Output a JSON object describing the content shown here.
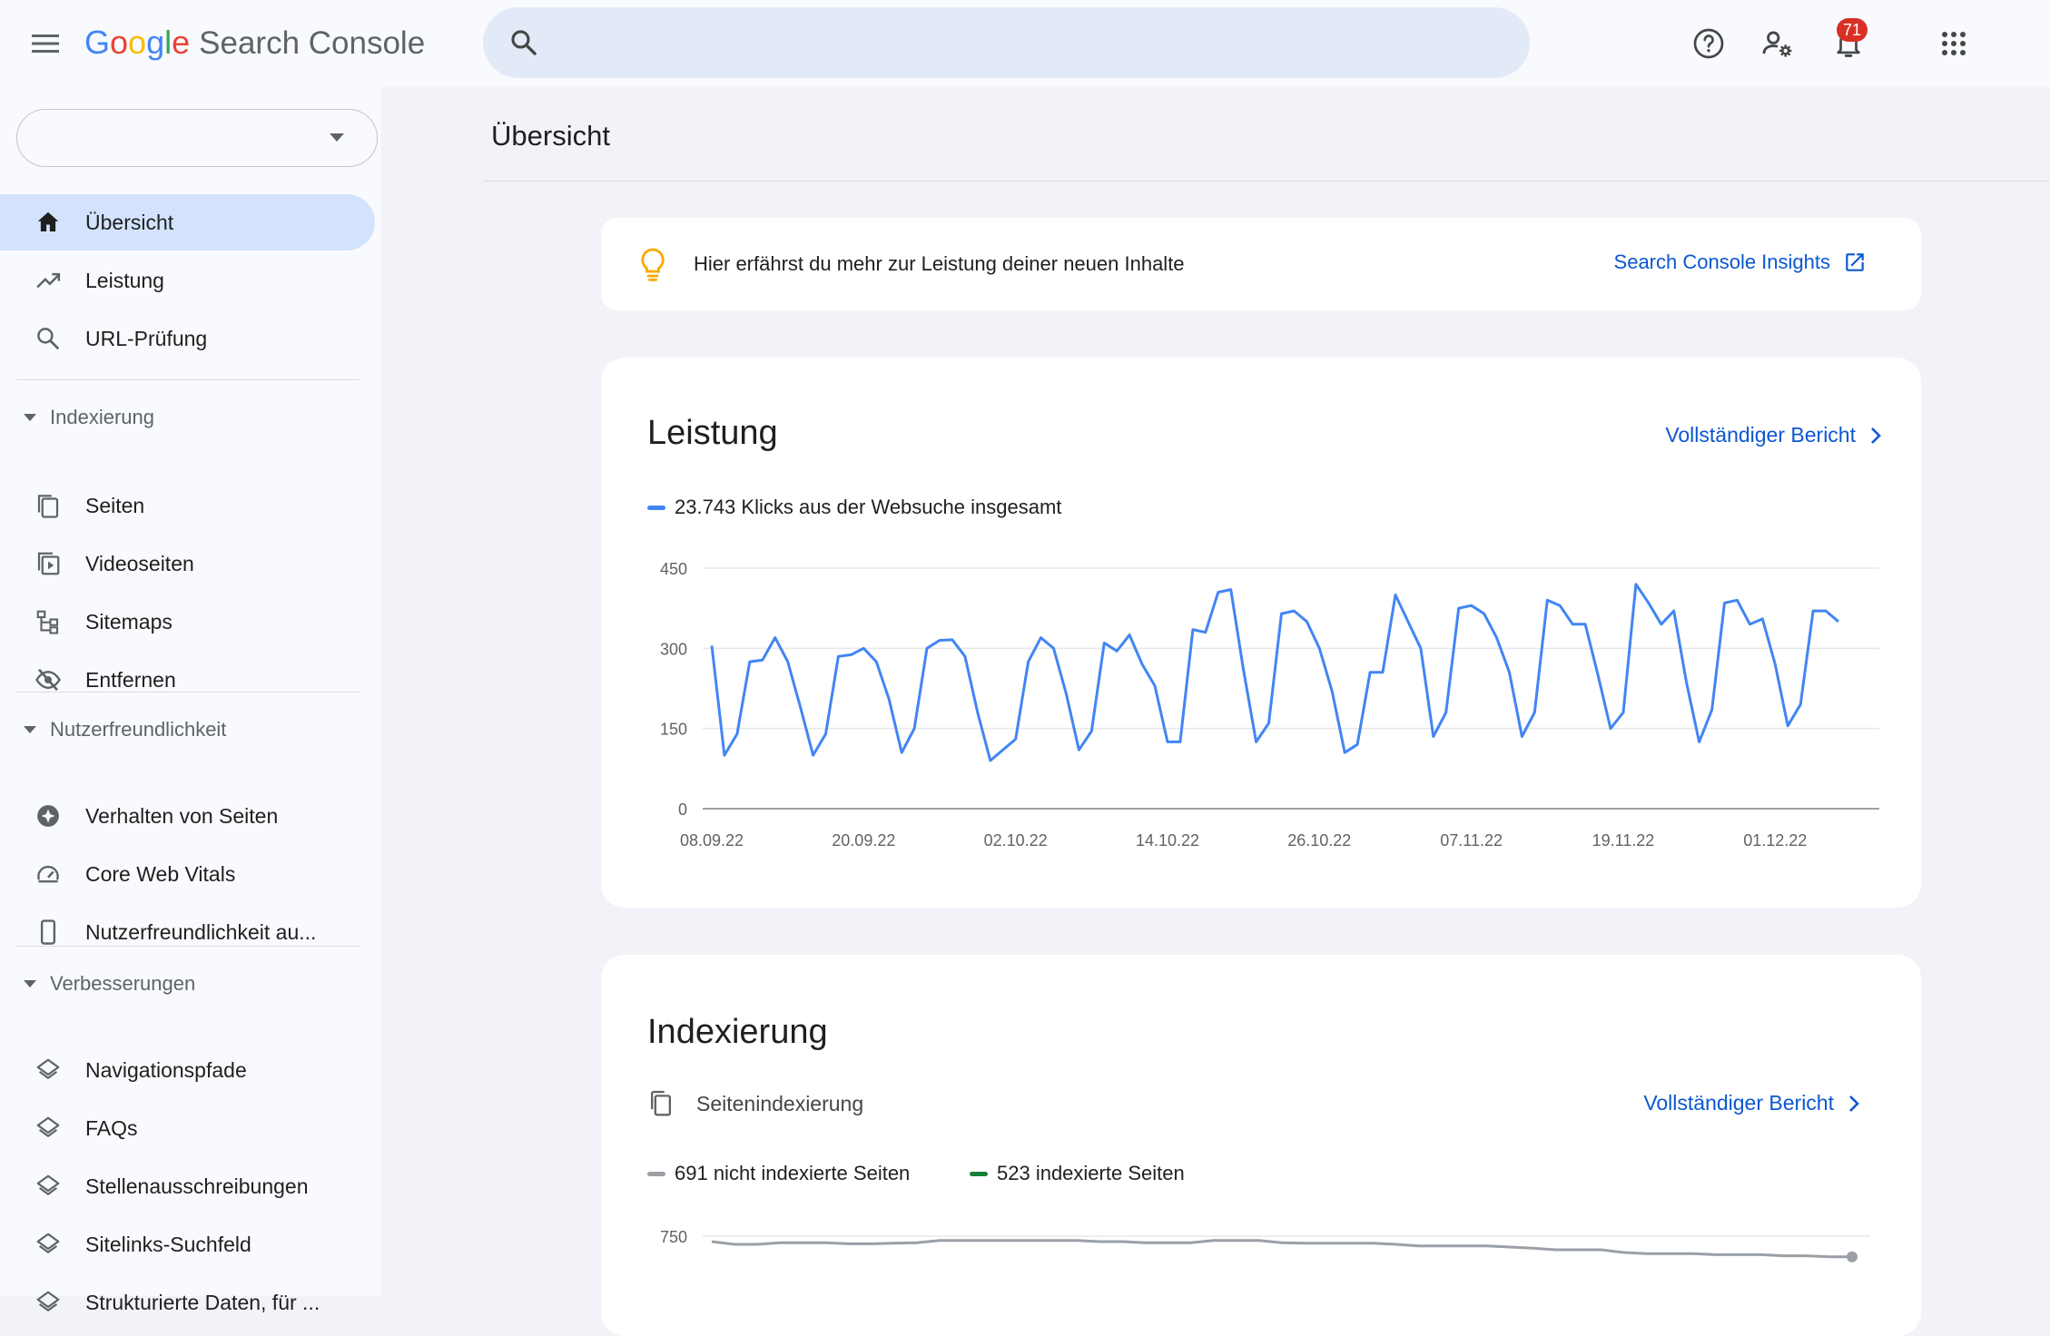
{
  "app": {
    "logo_letters": [
      {
        "ch": "G",
        "color": "#4285f4"
      },
      {
        "ch": "o",
        "color": "#ea4335"
      },
      {
        "ch": "o",
        "color": "#fbbc05"
      },
      {
        "ch": "g",
        "color": "#4285f4"
      },
      {
        "ch": "l",
        "color": "#34a853"
      },
      {
        "ch": "e",
        "color": "#ea4335"
      }
    ],
    "product": "Search Console"
  },
  "search": {
    "value": "",
    "placeholder": ""
  },
  "topbar": {
    "notification_count": "71"
  },
  "sidebar": {
    "property_value": "",
    "top_items": [
      {
        "label": "Übersicht",
        "icon": "home-icon",
        "active": true
      },
      {
        "label": "Leistung",
        "icon": "trending-up-icon",
        "active": false
      },
      {
        "label": "URL-Prüfung",
        "icon": "search-icon",
        "active": false
      }
    ],
    "sections": [
      {
        "title": "Indexierung",
        "items": [
          {
            "label": "Seiten",
            "icon": "pages-icon"
          },
          {
            "label": "Videoseiten",
            "icon": "video-pages-icon"
          },
          {
            "label": "Sitemaps",
            "icon": "sitemap-icon"
          },
          {
            "label": "Entfernen",
            "icon": "visibility-off-icon"
          }
        ]
      },
      {
        "title": "Nutzerfreundlichkeit",
        "items": [
          {
            "label": "Verhalten von Seiten",
            "icon": "page-experience-icon"
          },
          {
            "label": "Core Web Vitals",
            "icon": "speed-icon"
          },
          {
            "label": "Nutzerfreundlichkeit au...",
            "icon": "smartphone-icon"
          }
        ]
      },
      {
        "title": "Verbesserungen",
        "items": [
          {
            "label": "Navigationspfade",
            "icon": "layers-icon"
          },
          {
            "label": "FAQs",
            "icon": "layers-icon"
          },
          {
            "label": "Stellenausschreibungen",
            "icon": "layers-icon"
          },
          {
            "label": "Sitelinks-Suchfeld",
            "icon": "layers-icon"
          },
          {
            "label": "Strukturierte Daten, für ...",
            "icon": "layers-icon"
          }
        ]
      }
    ]
  },
  "main": {
    "title": "Übersicht",
    "insight": {
      "text": "Hier erfährst du mehr zur Leistung deiner neuen Inhalte",
      "link": "Search Console Insights"
    },
    "performance": {
      "title": "Leistung",
      "link": "Vollständiger Bericht",
      "legend": "23.743 Klicks aus der Websuche insgesamt"
    },
    "indexing": {
      "title": "Indexierung",
      "subtitle": "Seitenindexierung",
      "link": "Vollständiger Bericht",
      "legend_not_indexed": "691 nicht indexierte Seiten",
      "legend_indexed": "523 indexierte Seiten"
    }
  },
  "colors": {
    "accent": "#0b57d0",
    "clicks_line": "#4285f4",
    "not_indexed": "#9aa0a6",
    "indexed": "#188038",
    "active_nav": "#d3e3fd",
    "badge": "#d93025"
  },
  "chart_data": [
    {
      "type": "line",
      "ylim": [
        0,
        450
      ],
      "yticks": [
        0,
        150,
        300,
        450
      ],
      "xticks": [
        "08.09.22",
        "20.09.22",
        "02.10.22",
        "14.10.22",
        "26.10.22",
        "07.11.22",
        "19.11.22",
        "01.12.22"
      ],
      "series": [
        {
          "name": "23.743 Klicks aus der Websuche insgesamt",
          "color": "#4285f4",
          "values": [
            305,
            100,
            140,
            275,
            278,
            320,
            275,
            190,
            100,
            140,
            285,
            288,
            300,
            275,
            205,
            105,
            150,
            300,
            315,
            316,
            285,
            180,
            90,
            110,
            130,
            275,
            320,
            300,
            215,
            110,
            145,
            310,
            295,
            325,
            270,
            230,
            125,
            125,
            335,
            330,
            405,
            410,
            260,
            125,
            160,
            365,
            370,
            350,
            300,
            220,
            105,
            120,
            255,
            255,
            400,
            350,
            300,
            135,
            180,
            375,
            380,
            365,
            320,
            255,
            135,
            180,
            390,
            380,
            345,
            345,
            250,
            150,
            180,
            420,
            385,
            345,
            370,
            235,
            125,
            185,
            385,
            390,
            345,
            355,
            270,
            155,
            195,
            370,
            370,
            350
          ]
        }
      ]
    },
    {
      "type": "line",
      "yticks": [
        750
      ],
      "ylim": [
        0,
        800
      ],
      "series": [
        {
          "name": "691 nicht indexierte Seiten",
          "color": "#9aa0a6",
          "values": [
            740,
            735,
            735,
            738,
            738,
            738,
            736,
            736,
            737,
            738,
            742,
            742,
            742,
            742,
            742,
            742,
            742,
            740,
            740,
            738,
            738,
            738,
            742,
            742,
            742,
            738,
            737,
            737,
            737,
            737,
            735,
            732,
            732,
            732,
            732,
            730,
            728,
            725,
            725,
            725,
            720,
            718,
            718,
            718,
            716,
            716,
            716,
            714,
            714,
            712,
            712
          ]
        }
      ]
    }
  ]
}
